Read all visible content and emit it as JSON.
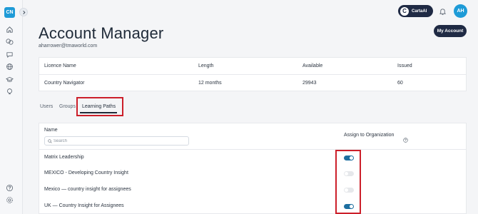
{
  "sidebar": {
    "logo_text": "CN",
    "items": [
      {
        "icon": "home-icon"
      },
      {
        "icon": "translate-icon"
      },
      {
        "icon": "chat-icon"
      },
      {
        "icon": "globe-icon"
      },
      {
        "icon": "graduation-cap-icon"
      },
      {
        "icon": "lightbulb-icon"
      }
    ],
    "bottom_items": [
      {
        "icon": "help-icon"
      },
      {
        "icon": "settings-icon"
      }
    ]
  },
  "topbar": {
    "carta_label": "CartaAI",
    "carta_icon_text": "C",
    "avatar_initials": "AH"
  },
  "header": {
    "title": "Account Manager",
    "email": "aharrower@tmaworld.com",
    "my_account_label": "My Account"
  },
  "licence": {
    "headers": [
      "Licence Name",
      "Length",
      "Available",
      "Issued"
    ],
    "row": [
      "Country Navigator",
      "12 months",
      "29943",
      "60"
    ]
  },
  "tabs": [
    {
      "label": "Users",
      "active": false
    },
    {
      "label": "Groups",
      "active": false
    },
    {
      "label": "Learning Paths",
      "active": true
    }
  ],
  "learning_paths": {
    "name_header": "Name",
    "search_placeholder": "Search",
    "assign_header": "Assign to Organization",
    "rows": [
      {
        "name": "Matrix Leadership",
        "assigned": true
      },
      {
        "name": "MEXICO - Developing Country Insight",
        "assigned": false
      },
      {
        "name": "Mexico — country insight for assignees",
        "assigned": false
      },
      {
        "name": "UK — Country Insight for Assignees",
        "assigned": true
      }
    ]
  },
  "colors": {
    "brand_blue": "#1f9bd7",
    "navy": "#1f2a44",
    "toggle_on": "#1e6fa0",
    "highlight_red": "#cc1f2a"
  }
}
